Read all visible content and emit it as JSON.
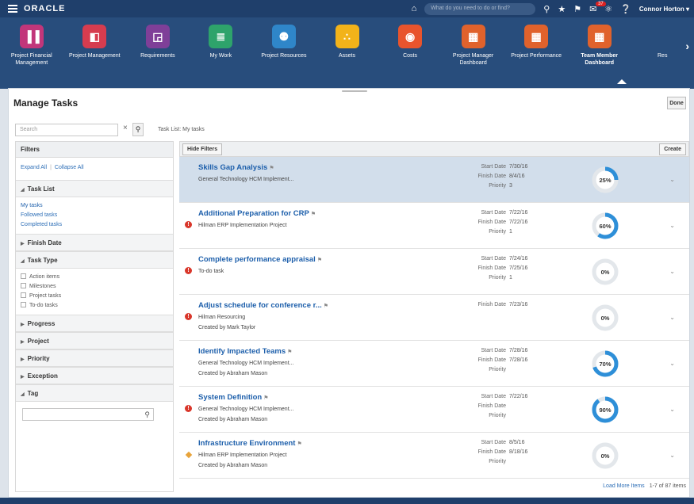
{
  "header": {
    "logo": "ORACLE",
    "search_placeholder": "What do you need to do or find?",
    "notifications": "37",
    "user": "Connor Horton ▾"
  },
  "springboard": {
    "apps": [
      {
        "label": "Project Financial Management",
        "color": "#c2367a",
        "glyph": "▐▐"
      },
      {
        "label": "Project Management",
        "color": "#d63c4f",
        "glyph": "◧"
      },
      {
        "label": "Requirements",
        "color": "#7f3f98",
        "glyph": "◲"
      },
      {
        "label": "My Work",
        "color": "#2ea36b",
        "glyph": "≣"
      },
      {
        "label": "Project Resources",
        "color": "#2f86c9",
        "glyph": "⚉"
      },
      {
        "label": "Assets",
        "color": "#f2b31a",
        "glyph": "∴"
      },
      {
        "label": "Costs",
        "color": "#e8542d",
        "glyph": "◉"
      },
      {
        "label": "Project Manager Dashboard",
        "color": "#e0622c",
        "glyph": "▦"
      },
      {
        "label": "Project Performance",
        "color": "#e0622c",
        "glyph": "▦"
      },
      {
        "label": "Team Member Dashboard",
        "color": "#e0622c",
        "glyph": "▦"
      },
      {
        "label": "Res",
        "color": "#284d7c",
        "glyph": ""
      }
    ]
  },
  "page": {
    "title": "Manage Tasks",
    "done": "Done",
    "search_placeholder": "Search",
    "breadcrumb": "Task List: My tasks"
  },
  "filters": {
    "heading": "Filters",
    "expand_all": "Expand All",
    "collapse_all": "Collapse All",
    "task_list": "Task List",
    "task_list_links": [
      "My tasks",
      "Followed tasks",
      "Completed tasks"
    ],
    "finish_date": "Finish Date",
    "task_type": "Task Type",
    "task_types": [
      "Action items",
      "Milestones",
      "Project tasks",
      "To-do tasks"
    ],
    "progress": "Progress",
    "project": "Project",
    "priority": "Priority",
    "exception": "Exception",
    "tag": "Tag"
  },
  "toolbar": {
    "hide_filters": "Hide Filters",
    "create": "Create"
  },
  "tasks": [
    {
      "title": "Skills Gap Analysis",
      "line2": "General Technology HCM Implement...",
      "line3": "",
      "start_label": "Start Date",
      "start": "7/30/16",
      "finish_label": "Finish Date",
      "finish": "8/4/16",
      "priority_label": "Priority",
      "priority": "3",
      "progress": 25,
      "pct": "25%",
      "status": "none"
    },
    {
      "title": "Additional Preparation for CRP",
      "line2": "Hilman ERP Implementation Project",
      "line3": "",
      "start_label": "Start Date",
      "start": "7/22/16",
      "finish_label": "Finish Date",
      "finish": "7/22/16",
      "priority_label": "Priority",
      "priority": "1",
      "progress": 60,
      "pct": "60%",
      "status": "error"
    },
    {
      "title": "Complete performance appraisal",
      "line2": "To-do task",
      "line3": "",
      "start_label": "Start Date",
      "start": "7/24/16",
      "finish_label": "Finish Date",
      "finish": "7/25/16",
      "priority_label": "Priority",
      "priority": "1",
      "progress": 0,
      "pct": "0%",
      "status": "error"
    },
    {
      "title": "Adjust schedule for conference r...",
      "line2": "Hilman Resourcing",
      "line3": "Created by Mark Taylor",
      "start_label": "",
      "start": "",
      "finish_label": "Finish Date",
      "finish": "7/23/16",
      "priority_label": "",
      "priority": "",
      "progress": 0,
      "pct": "0%",
      "status": "error"
    },
    {
      "title": "Identify Impacted Teams",
      "line2": "General Technology HCM Implement...",
      "line3": "Created by Abraham Mason",
      "start_label": "Start Date",
      "start": "7/28/16",
      "finish_label": "Finish Date",
      "finish": "7/28/16",
      "priority_label": "Priority",
      "priority": "",
      "progress": 70,
      "pct": "70%",
      "status": "none"
    },
    {
      "title": "System Definition",
      "line2": "General Technology HCM Implement...",
      "line3": "Created by Abraham Mason",
      "start_label": "Start Date",
      "start": "7/22/16",
      "finish_label": "Finish Date",
      "finish": "",
      "priority_label": "Priority",
      "priority": "",
      "progress": 90,
      "pct": "90%",
      "status": "error"
    },
    {
      "title": "Infrastructure Environment",
      "line2": "Hilman ERP Implementation Project",
      "line3": "Created by Abraham Mason",
      "start_label": "Start Date",
      "start": "8/5/16",
      "finish_label": "Finish Date",
      "finish": "8/18/16",
      "priority_label": "Priority",
      "priority": "",
      "progress": 0,
      "pct": "0%",
      "status": "warning"
    }
  ],
  "footer": {
    "load_more": "Load More Items",
    "count": "1-7 of 87 items"
  },
  "colors": {
    "ring": "#2e8fd8",
    "ring_track": "#e3e7eb"
  }
}
